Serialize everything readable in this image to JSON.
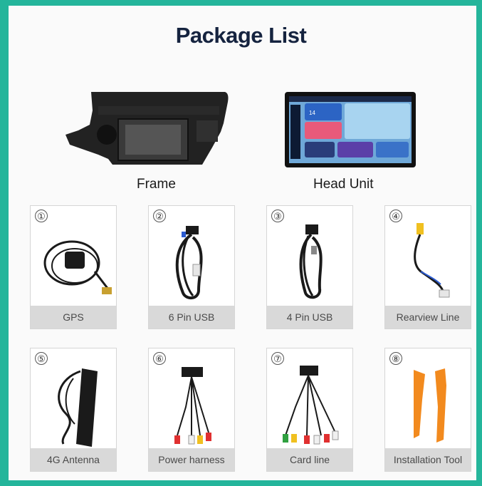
{
  "title": "Package List",
  "main_items": [
    {
      "label": "Frame"
    },
    {
      "label": "Head Unit"
    }
  ],
  "head_unit_screen": {
    "time": "14"
  },
  "items": [
    {
      "number": "①",
      "label": "GPS"
    },
    {
      "number": "②",
      "label": "6 Pin USB"
    },
    {
      "number": "③",
      "label": "4 Pin USB"
    },
    {
      "number": "④",
      "label": "Rearview Line"
    },
    {
      "number": "⑤",
      "label": "4G Antenna"
    },
    {
      "number": "⑥",
      "label": "Power harness"
    },
    {
      "number": "⑦",
      "label": "Card line"
    },
    {
      "number": "⑧",
      "label": "Installation Tool"
    }
  ],
  "colors": {
    "border": "#24b59b",
    "title": "#15233f",
    "caption_bg": "#d9d9d9",
    "tool_orange": "#f28a1e"
  }
}
